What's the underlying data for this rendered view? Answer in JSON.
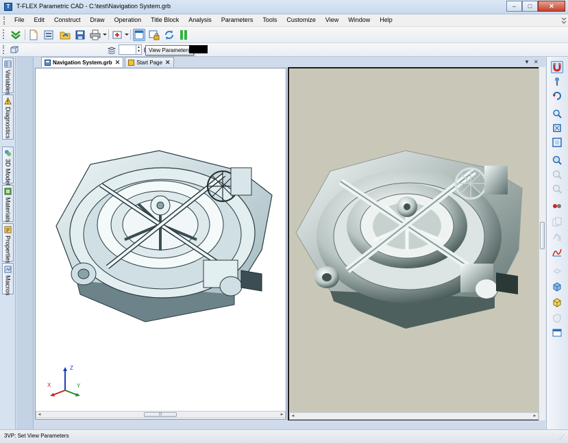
{
  "window": {
    "title": "T-FLEX Parametric CAD - C:\\test\\Navigation System.grb",
    "app_icon_letter": "T",
    "minimize": "–",
    "maximize": "□",
    "close": "✕"
  },
  "menu": {
    "items": [
      "File",
      "Edit",
      "Construct",
      "Draw",
      "Operation",
      "Title Block",
      "Analysis",
      "Parameters",
      "Tools",
      "Customize",
      "View",
      "Window",
      "Help"
    ]
  },
  "toolbar": {
    "icons": [
      "ok-check-icon",
      "new-file-icon",
      "open-file-icon",
      "open-folder-icon",
      "save-icon",
      "print-icon",
      "snap-icon",
      "view-parameters-icon",
      "lock-view-icon",
      "regenerate-icon",
      "pause-icon"
    ],
    "tooltip": "View Parameters",
    "layer_combo_value": ""
  },
  "left_dock": {
    "tabs": [
      {
        "icon": "variables-icon",
        "label": "Variables"
      },
      {
        "icon": "diagnostics-icon",
        "label": "Diagnostics"
      },
      {
        "icon": "3d-model-icon",
        "label": "3D Model"
      },
      {
        "icon": "materials-icon",
        "label": "Materials"
      },
      {
        "icon": "properties-icon",
        "label": "Properties"
      },
      {
        "icon": "macros-icon",
        "label": "Macros"
      }
    ]
  },
  "documents": {
    "tabs": [
      {
        "label": "Navigation System.grb",
        "active": true,
        "close": "✕"
      },
      {
        "label": "Start Page",
        "active": false,
        "close": "✕"
      }
    ],
    "tab_menu_arrow": "▼",
    "tab_close_all": "✕"
  },
  "viewport": {
    "left_background": "#ffffff",
    "right_background": "#c9c8b8",
    "triad": {
      "x_label": "X",
      "y_label": "Y",
      "z_label": "Z"
    },
    "scroll_thumb_grip": "|||"
  },
  "right_toolbar": {
    "icons": [
      "magnet-icon",
      "pin-icon",
      "undo-view-icon",
      "zoom-window-icon",
      "zoom-extents-icon",
      "zoom-fit-icon",
      "zoom-in-icon",
      "zoom-out-icon",
      "zoom-previous-icon",
      "hide-icon",
      "copy-icon",
      "shading-icon",
      "curve-icon",
      "layer-icon",
      "cube-front-icon",
      "cube-iso-icon",
      "shield-icon",
      "panel-icon"
    ]
  },
  "status": {
    "text": "3VP: Set View Parameters"
  },
  "colors": {
    "accent": "#2a6db7",
    "active_frame": "#1e1e1e"
  }
}
